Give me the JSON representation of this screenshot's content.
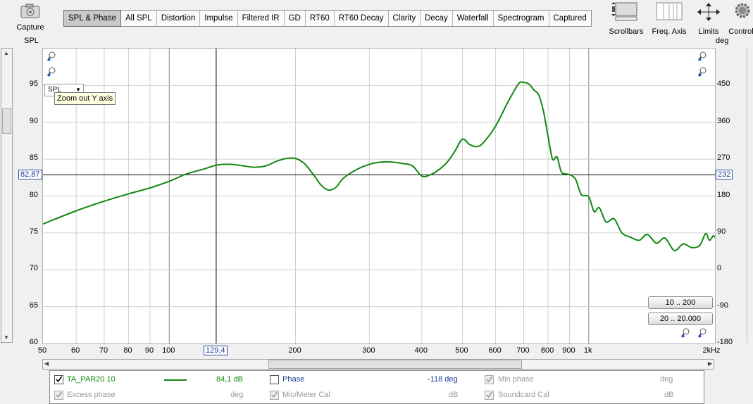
{
  "toolbar": {
    "capture_label": "Capture",
    "tabs": [
      {
        "label": "SPL & Phase",
        "active": true
      },
      {
        "label": "All SPL"
      },
      {
        "label": "Distortion"
      },
      {
        "label": "Impulse"
      },
      {
        "label": "Filtered IR"
      },
      {
        "label": "GD"
      },
      {
        "label": "RT60"
      },
      {
        "label": "RT60 Decay"
      },
      {
        "label": "Clarity"
      },
      {
        "label": "Decay"
      },
      {
        "label": "Waterfall"
      },
      {
        "label": "Spectrogram"
      },
      {
        "label": "Captured"
      }
    ],
    "scrollbars_label": "Scrollbars",
    "freq_axis_label": "Freq. Axis",
    "limits_label": "Limits",
    "controls_label": "Control"
  },
  "axes": {
    "left_unit": "SPL",
    "right_unit": "deg",
    "left_ticks": [
      "95",
      "90",
      "85",
      "80",
      "75",
      "70",
      "65",
      "60"
    ],
    "right_ticks": [
      "450",
      "360",
      "270",
      "180",
      "90",
      "0",
      "-90",
      "-180"
    ],
    "x_ticks": [
      "50",
      "60",
      "70",
      "80",
      "90",
      "100",
      "200",
      "300",
      "400",
      "500",
      "600",
      "700",
      "800",
      "900",
      "1k",
      "2kHz"
    ]
  },
  "cursor": {
    "y_value": "82,87",
    "phase_value": "232",
    "x_value": "129,4"
  },
  "plot": {
    "selector_value": "SPL",
    "tooltip": "Zoom out Y axis",
    "range_button_1": "10 .. 200",
    "range_button_2": "20 .. 20.000"
  },
  "legend": {
    "row1": {
      "trace_name": "TA_PAR20 10",
      "trace_value": "84,1 dB",
      "phase_label": "Phase",
      "phase_value": "-118 deg",
      "min_phase_label": "Min phase",
      "min_phase_unit": "deg"
    },
    "row2": {
      "excess_label": "Excess phase",
      "excess_unit": "deg",
      "mic_label": "Mic/Meter Cal",
      "mic_unit": "dB",
      "soundcard_label": "Soundcard Cal",
      "soundcard_unit": "dB"
    }
  },
  "colors": {
    "trace": "#118811",
    "cursor_label": "#1a3a90"
  },
  "chart_data": {
    "type": "line",
    "xscale": "log",
    "xlim": [
      50,
      2000
    ],
    "ylim": [
      60,
      100
    ],
    "phase_lim": [
      -180,
      540
    ],
    "series": [
      {
        "name": "TA_PAR20 10",
        "x": [
          50,
          60,
          70,
          80,
          90,
          100,
          110,
          120,
          130,
          140,
          150,
          160,
          170,
          180,
          190,
          200,
          210,
          220,
          230,
          240,
          250,
          260,
          280,
          300,
          320,
          340,
          360,
          380,
          400,
          420,
          440,
          460,
          480,
          500,
          520,
          540,
          560,
          600,
          640,
          680,
          700,
          720,
          740,
          760,
          780,
          800,
          820,
          840,
          860,
          880,
          900,
          930,
          960,
          1000,
          1030,
          1060,
          1100,
          1150,
          1200,
          1260,
          1320,
          1380,
          1450,
          1520,
          1600,
          1680,
          1760,
          1840,
          1900,
          1940,
          1980,
          2000
        ],
        "y": [
          76.2,
          78.0,
          79.3,
          80.3,
          81.1,
          82.0,
          83.0,
          83.6,
          84.2,
          84.3,
          84.1,
          83.9,
          84.1,
          84.7,
          85.1,
          85.1,
          84.4,
          83.0,
          81.5,
          80.8,
          81.2,
          82.4,
          83.6,
          84.3,
          84.6,
          84.6,
          84.4,
          84.1,
          82.7,
          82.9,
          83.6,
          84.6,
          86.1,
          87.7,
          87.0,
          86.7,
          87.2,
          89.5,
          92.6,
          95.2,
          95.4,
          95.2,
          94.4,
          93.7,
          91.5,
          88.1,
          85.0,
          85.3,
          83.3,
          83.0,
          82.9,
          82.3,
          80.2,
          79.9,
          77.9,
          78.4,
          76.5,
          76.9,
          75.0,
          74.4,
          74.0,
          74.8,
          73.6,
          74.3,
          72.6,
          73.5,
          73.0,
          73.3,
          74.9,
          74.0,
          74.6,
          74.4
        ]
      }
    ]
  }
}
